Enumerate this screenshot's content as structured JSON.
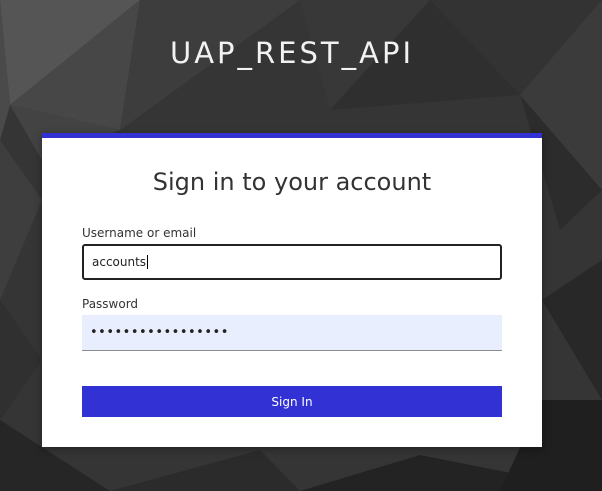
{
  "realm": {
    "title": "UAP_REST_API"
  },
  "login_form": {
    "heading": "Sign in to your account",
    "username": {
      "label": "Username or email",
      "value": "accounts"
    },
    "password": {
      "label": "Password",
      "masked_value": "•••••••••••••••••"
    },
    "submit_label": "Sign In"
  },
  "colors": {
    "accent": "#3131d4",
    "background": "#3a3a3a",
    "card": "#ffffff",
    "password_fill": "#e8eefd"
  }
}
